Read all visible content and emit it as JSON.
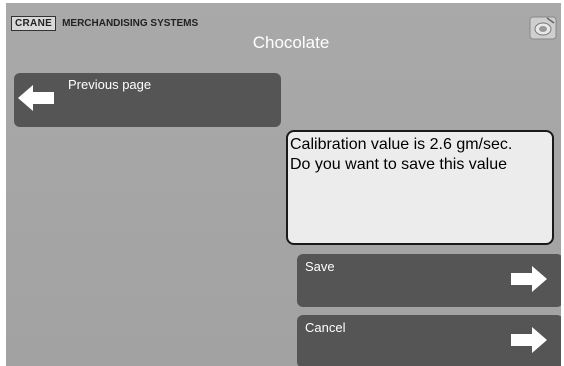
{
  "header": {
    "brand_box": "CRANE",
    "brand_text": "MERCHANDISING SYSTEMS",
    "title": "Chocolate"
  },
  "nav": {
    "previous_label": "Previous page"
  },
  "message": {
    "line1": "Calibration value is 2.6 gm/sec.",
    "line2": "Do you want to save this value"
  },
  "actions": {
    "save_label": "Save",
    "cancel_label": "Cancel"
  },
  "icons": {
    "back": "arrow-left-icon",
    "forward": "arrow-right-icon",
    "corner": "machine-icon"
  }
}
